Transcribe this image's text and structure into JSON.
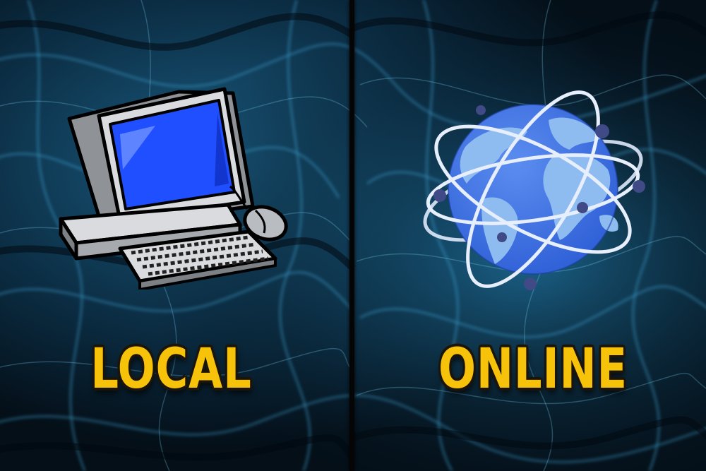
{
  "colors": {
    "background": "#061621",
    "label": "#f7c30a",
    "screen": "#1f4fff",
    "globe": "#3f74e6",
    "land": "#8fbcf0"
  },
  "options": [
    {
      "id": "local",
      "label": "LOCAL",
      "icon": "computer-icon"
    },
    {
      "id": "online",
      "label": "ONLINE",
      "icon": "globe-icon"
    }
  ]
}
